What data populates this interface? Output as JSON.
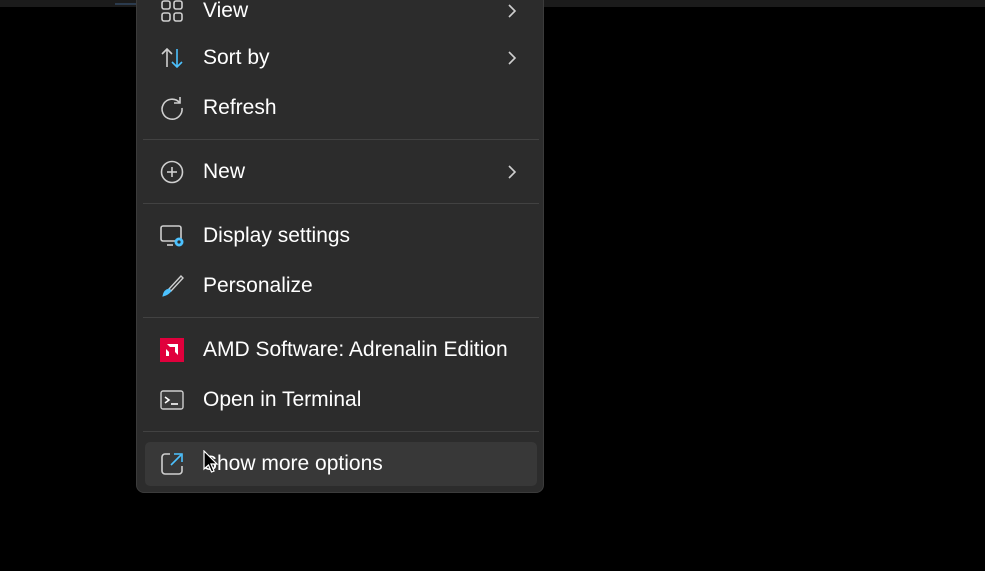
{
  "menu": {
    "items": [
      {
        "label": "View",
        "icon": "view-grid-icon",
        "submenu": true
      },
      {
        "label": "Sort by",
        "icon": "sort-arrows-icon",
        "submenu": true
      },
      {
        "label": "Refresh",
        "icon": "refresh-icon",
        "submenu": false
      },
      {
        "label": "New",
        "icon": "plus-circle-icon",
        "submenu": true
      },
      {
        "label": "Display settings",
        "icon": "display-settings-icon",
        "submenu": false
      },
      {
        "label": "Personalize",
        "icon": "brush-icon",
        "submenu": false
      },
      {
        "label": "AMD Software: Adrenalin Edition",
        "icon": "amd-logo-icon",
        "submenu": false
      },
      {
        "label": "Open in Terminal",
        "icon": "terminal-icon",
        "submenu": false
      },
      {
        "label": "Show more options",
        "icon": "show-more-options-icon",
        "submenu": false,
        "hovered": true
      }
    ]
  },
  "colors": {
    "background": "#000000",
    "menu_bg": "#2c2c2c",
    "hover_bg": "#383838",
    "separator": "#424242",
    "text": "#ffffff",
    "accent_blue": "#4cc2ff",
    "amd_red": "#e0003c"
  }
}
